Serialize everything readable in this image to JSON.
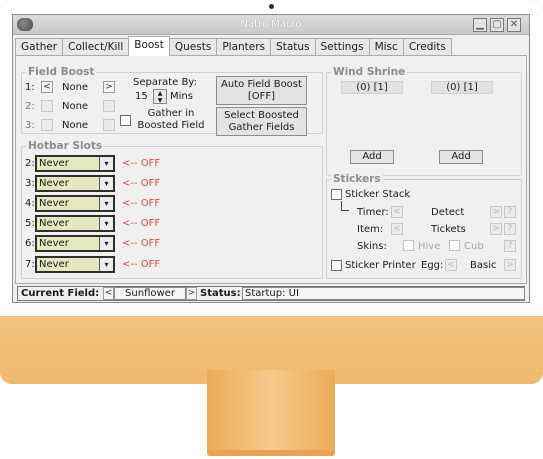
{
  "window": {
    "title": "Natro Macro"
  },
  "tabs": [
    "Gather",
    "Collect/Kill",
    "Boost",
    "Quests",
    "Planters",
    "Status",
    "Settings",
    "Misc",
    "Credits"
  ],
  "active_tab": "Boost",
  "field_boost": {
    "title": "Field Boost",
    "rows": [
      {
        "label": "1:",
        "value": "None"
      },
      {
        "label": "2:",
        "value": "None"
      },
      {
        "label": "3:",
        "value": "None"
      }
    ],
    "separate_by_label": "Separate By:",
    "separate_by_value": "15",
    "separate_by_unit": "Mins",
    "gather_in_boosted_label": "Gather in Boosted Field",
    "auto_field_boost_label": "Auto Field Boost [OFF]",
    "select_boosted_label": "Select Boosted Gather Fields"
  },
  "wind_shrine": {
    "title": "Wind Shrine",
    "slots": [
      {
        "value": "(0) [1]",
        "add_label": "Add"
      },
      {
        "value": "(0) [1]",
        "add_label": "Add"
      }
    ]
  },
  "hotbar": {
    "title": "Hotbar Slots",
    "slots": [
      {
        "label": "2:",
        "value": "Never",
        "status": "<-- OFF"
      },
      {
        "label": "3:",
        "value": "Never",
        "status": "<-- OFF"
      },
      {
        "label": "4:",
        "value": "Never",
        "status": "<-- OFF"
      },
      {
        "label": "5:",
        "value": "Never",
        "status": "<-- OFF"
      },
      {
        "label": "6:",
        "value": "Never",
        "status": "<-- OFF"
      },
      {
        "label": "7:",
        "value": "Never",
        "status": "<-- OFF"
      }
    ]
  },
  "stickers": {
    "title": "Stickers",
    "sticker_stack_label": "Sticker Stack",
    "timer_label": "Timer:",
    "timer_value": "Detect",
    "item_label": "Item:",
    "item_value": "Tickets",
    "skins_label": "Skins:",
    "hive_label": "Hive",
    "cub_label": "Cub",
    "sticker_printer_label": "Sticker Printer",
    "egg_label": "Egg:",
    "egg_value": "Basic"
  },
  "statusbar": {
    "current_field_label": "Current Field:",
    "current_field_value": "Sunflower",
    "status_label": "Status:",
    "status_value": "Startup: UI"
  },
  "colors": {
    "monitor": "#f0bd77",
    "off_text": "#e04a3a",
    "select_fill": "#e7e7c0"
  }
}
